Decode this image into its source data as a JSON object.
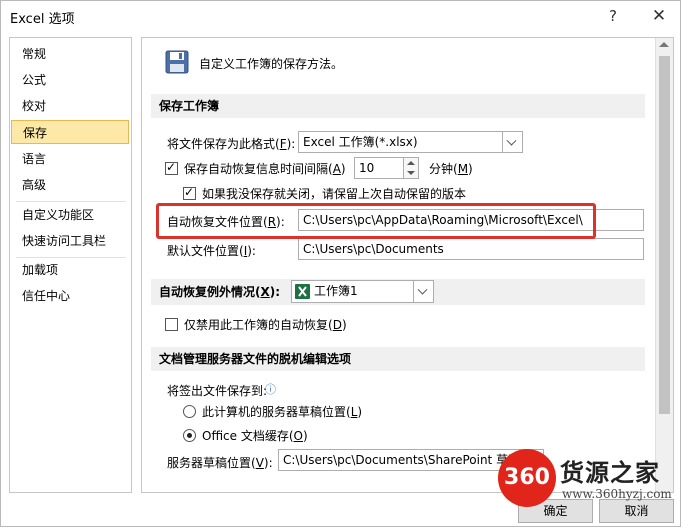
{
  "window": {
    "title": "Excel 选项",
    "help_glyph": "?",
    "close_glyph": "✕"
  },
  "sidebar": {
    "items": [
      {
        "label": "常规"
      },
      {
        "label": "公式"
      },
      {
        "label": "校对"
      },
      {
        "label": "保存",
        "active": true
      },
      {
        "label": "语言"
      },
      {
        "label": "高级"
      },
      {
        "label": "自定义功能区"
      },
      {
        "label": "快速访问工具栏"
      },
      {
        "label": "加载项"
      },
      {
        "label": "信任中心"
      }
    ]
  },
  "main": {
    "header_text": "自定义工作簿的保存方法。",
    "save_section": {
      "title": "保存工作簿",
      "format_label": "将文件保存为此格式(",
      "format_key": "F",
      "format_label_end": "):",
      "format_value": "Excel 工作簿(*.xlsx)",
      "autorecover_label": "保存自动恢复信息时间间隔(",
      "autorecover_key": "A",
      "autorecover_label_end": ")",
      "autorecover_checked": true,
      "autorecover_minutes": "10",
      "minutes_label": "分钟(",
      "minutes_key": "M",
      "minutes_label_end": ")",
      "keep_last_label": "如果我没保存就关闭，请保留上次自动保留的版本",
      "keep_last_checked": true,
      "autorecover_loc_label": "自动恢复文件位置(",
      "autorecover_loc_key": "R",
      "autorecover_loc_label_end": "):",
      "autorecover_loc_value": "C:\\Users\\pc\\AppData\\Roaming\\Microsoft\\Excel\\",
      "default_loc_label": "默认文件位置(",
      "default_loc_key": "I",
      "default_loc_label_end": "):",
      "default_loc_value": "C:\\Users\\pc\\Documents"
    },
    "exceptions_section": {
      "title_prefix": "自动恢复例外情况(",
      "title_key": "X",
      "title_suffix": "):",
      "workbook_value": "工作簿1",
      "disable_label": "仅禁用此工作簿的自动恢复(",
      "disable_key": "D",
      "disable_label_end": ")",
      "disable_checked": false
    },
    "offline_section": {
      "title": "文档管理服务器文件的脱机编辑选项",
      "save_checkout_label": "将签出文件保存到:",
      "info_glyph": "ⓘ",
      "option_local_label": "此计算机的服务器草稿位置(",
      "option_local_key": "L",
      "option_local_label_end": ")",
      "option_local_checked": false,
      "option_cache_label": "Office 文档缓存(",
      "option_cache_key": "O",
      "option_cache_label_end": ")",
      "option_cache_checked": true,
      "drafts_label": "服务器草稿位置(",
      "drafts_key": "V",
      "drafts_label_end": "):",
      "drafts_value": "C:\\Users\\pc\\Documents\\SharePoint 草稿\\"
    }
  },
  "footer": {
    "ok_label": "确定",
    "cancel_label": "取消"
  },
  "watermark": {
    "circle_text": "360",
    "name": "货源之家",
    "url": "www.360hyzj.com"
  },
  "colors": {
    "highlight_border": "#d9342b",
    "active_nav_bg": "#fde8a8",
    "section_bg": "#f0f0f0"
  }
}
